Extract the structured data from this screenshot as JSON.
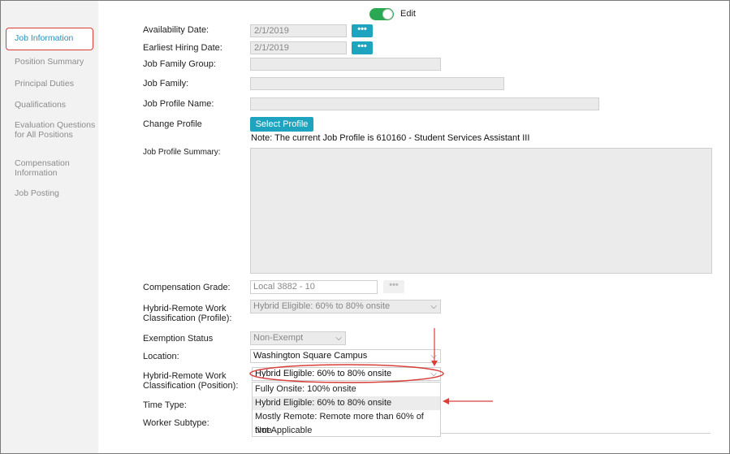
{
  "header": {
    "edit_label": "Edit",
    "edit_enabled": true
  },
  "sidebar": {
    "items": [
      {
        "label": "Job Information",
        "active": true
      },
      {
        "label": "Position Summary"
      },
      {
        "label": "Principal Duties"
      },
      {
        "label": "Qualifications"
      },
      {
        "label": "Evaluation Questions for All Positions"
      },
      {
        "label": "Compensation Information"
      },
      {
        "label": "Job Posting"
      }
    ]
  },
  "form": {
    "availability_date": {
      "label": "Availability Date:",
      "value": "2/1/2019"
    },
    "earliest_hiring_date": {
      "label": "Earliest Hiring Date:",
      "value": "2/1/2019"
    },
    "job_family_group": {
      "label": "Job Family Group:"
    },
    "job_family": {
      "label": "Job Family:"
    },
    "job_profile_name": {
      "label": "Job Profile Name:"
    },
    "change_profile": {
      "label": "Change Profile",
      "button": "Select Profile"
    },
    "note": "Note: The current Job Profile is 610160 - Student Services Assistant III",
    "job_profile_summary": {
      "label": "Job Profile Summary:"
    },
    "compensation_grade": {
      "label": "Compensation Grade:",
      "value": "Local 3882 - 10"
    },
    "hybrid_profile": {
      "label_line1": "Hybrid-Remote Work",
      "label_line2": "Classification (Profile):",
      "value": "Hybrid Eligible: 60% to 80% onsite"
    },
    "exemption_status": {
      "label": "Exemption Status",
      "value": "Non-Exempt"
    },
    "location": {
      "label": "Location:",
      "value": "Washington Square Campus"
    },
    "hybrid_position": {
      "label_line1": "Hybrid-Remote Work",
      "label_line2": "Classification (Position):",
      "value": "Hybrid Eligible: 60% to 80% onsite",
      "options": [
        "Fully Onsite: 100% onsite",
        "Hybrid Eligible: 60% to 80% onsite",
        "Mostly Remote: Remote more than 60% of time",
        "Not Applicable"
      ],
      "highlighted_option_index": 1
    },
    "time_type": {
      "label": "Time Type:"
    },
    "worker_subtype": {
      "label": "Worker Subtype:"
    }
  },
  "icons": {
    "ellipsis": "•••",
    "chevron": "⌵"
  },
  "colors": {
    "accent": "#1fa4bf",
    "toggle_on": "#2aa853",
    "annotation_red": "#d9403a",
    "active_link": "#2a8fb8"
  }
}
